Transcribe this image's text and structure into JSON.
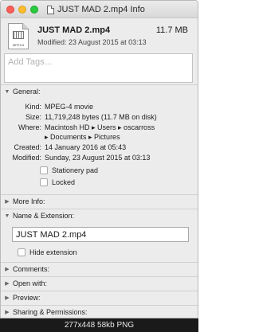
{
  "window": {
    "title": "JUST MAD 2.mp4 Info"
  },
  "header": {
    "file_name": "JUST MAD 2.mp4",
    "file_size": "11.7 MB",
    "modified": "Modified: 23 August 2015 at 03:13",
    "icon_ext": "MPEG4"
  },
  "tags": {
    "placeholder": "Add Tags..."
  },
  "general": {
    "label": "General:",
    "rows": [
      {
        "key": "Kind:",
        "value": "MPEG-4 movie"
      },
      {
        "key": "Size:",
        "value": "11,719,248 bytes (11.7 MB on disk)"
      },
      {
        "key": "Where:",
        "value": "Macintosh HD ▸ Users ▸ oscarross"
      },
      {
        "key": "",
        "value": "▸ Documents ▸ Pictures"
      },
      {
        "key": "Created:",
        "value": "14 January 2016 at 05:43"
      },
      {
        "key": "Modified:",
        "value": "Sunday, 23 August 2015 at 03:13"
      }
    ],
    "stationery_pad": "Stationery pad",
    "locked": "Locked"
  },
  "more_info": {
    "label": "More Info:"
  },
  "name_extension": {
    "label": "Name & Extension:",
    "value": "JUST MAD 2.mp4",
    "hide_extension": "Hide extension"
  },
  "comments": {
    "label": "Comments:"
  },
  "open_with": {
    "label": "Open with:"
  },
  "preview": {
    "label": "Preview:"
  },
  "sharing": {
    "label": "Sharing & Permissions:"
  },
  "footer": {
    "caption": "277x448 58kb PNG"
  }
}
